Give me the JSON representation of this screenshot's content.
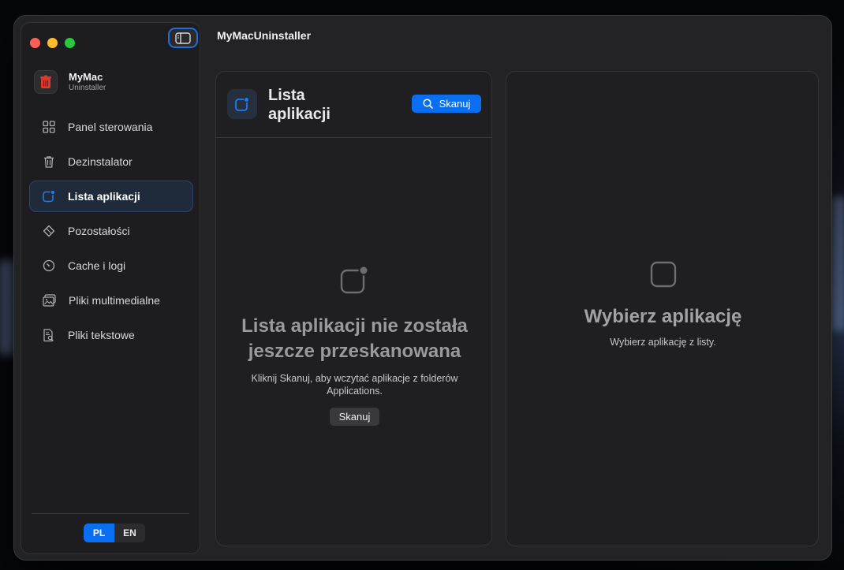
{
  "app": {
    "title": "MyMacUninstaller"
  },
  "brand": {
    "name": "MyMac",
    "subtitle": "Uninstaller"
  },
  "sidebar": {
    "items": [
      {
        "label": "Panel sterowania",
        "icon": "grid-icon",
        "active": false
      },
      {
        "label": "Dezinstalator",
        "icon": "trash-icon",
        "active": false
      },
      {
        "label": "Lista aplikacji",
        "icon": "app-list-icon",
        "active": true
      },
      {
        "label": "Pozostałości",
        "icon": "eraser-icon",
        "active": false
      },
      {
        "label": "Cache i logi",
        "icon": "gauge-icon",
        "active": false
      },
      {
        "label": "Pliki multimedialne",
        "icon": "photos-icon",
        "active": false
      },
      {
        "label": "Pliki tekstowe",
        "icon": "document-search-icon",
        "active": false
      }
    ]
  },
  "language": {
    "options": [
      "PL",
      "EN"
    ],
    "selected": "PL"
  },
  "app_list_panel": {
    "title": "Lista aplikacji",
    "scan_label": "Skanuj",
    "empty_title": "Lista aplikacji nie została jeszcze przeskanowana",
    "empty_description": "Kliknij Skanuj, aby wczytać aplikacje z folderów Applications.",
    "empty_button": "Skanuj"
  },
  "detail_panel": {
    "empty_title": "Wybierz aplikację",
    "empty_description": "Wybierz aplikację z listy."
  },
  "colors": {
    "accent": "#0a6ef0",
    "active_bg": "#1f2a3a",
    "logo_red": "#e0362c"
  }
}
